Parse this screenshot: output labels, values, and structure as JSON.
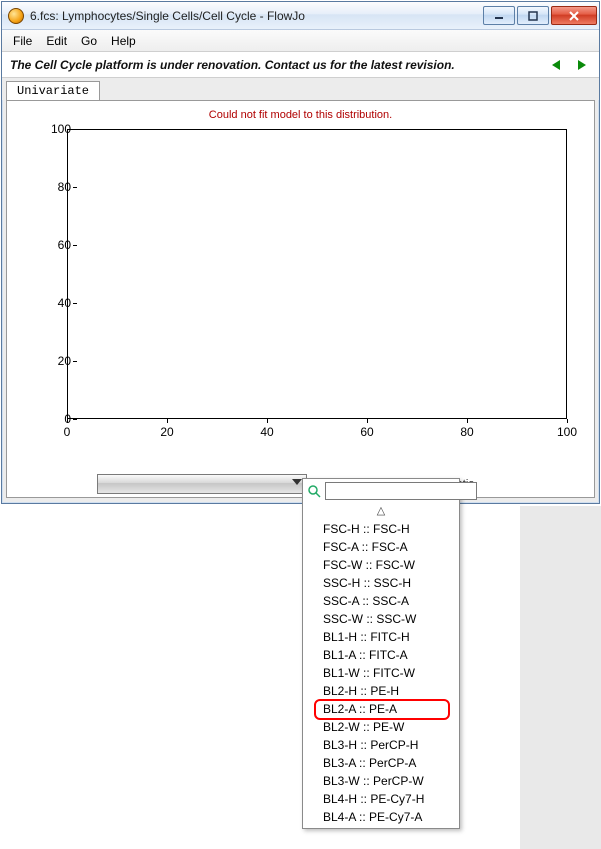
{
  "window": {
    "title": "6.fcs: Lymphocytes/Single Cells/Cell Cycle - FlowJo"
  },
  "menu": {
    "items": [
      "File",
      "Edit",
      "Go",
      "Help"
    ]
  },
  "banner": {
    "message": "The Cell Cycle platform is under renovation.  Contact us for the latest revision."
  },
  "tabs": {
    "active": "Univariate"
  },
  "plot": {
    "fit_error": "Could not fit model to this distribution."
  },
  "bottom": {
    "constrain_label": "ain Ratio"
  },
  "dropdown": {
    "sort_hint": "△",
    "items": [
      "FSC-H :: FSC-H",
      "FSC-A :: FSC-A",
      "FSC-W :: FSC-W",
      "SSC-H :: SSC-H",
      "SSC-A :: SSC-A",
      "SSC-W :: SSC-W",
      "BL1-H :: FITC-H",
      "BL1-A :: FITC-A",
      "BL1-W :: FITC-W",
      "BL2-H :: PE-H",
      "BL2-A :: PE-A",
      "BL2-W :: PE-W",
      "BL3-H :: PerCP-H",
      "BL3-A :: PerCP-A",
      "BL3-W :: PerCP-W",
      "BL4-H :: PE-Cy7-H",
      "BL4-A :: PE-Cy7-A"
    ],
    "highlighted_index": 10
  },
  "chart_data": {
    "type": "line",
    "series": [],
    "x": [],
    "y": [],
    "xlabel": "",
    "ylabel": "",
    "xticks": [
      0,
      20,
      40,
      60,
      80,
      100
    ],
    "yticks": [
      0,
      20,
      40,
      60,
      80,
      100
    ],
    "xlim": [
      0,
      100
    ],
    "ylim": [
      0,
      100
    ],
    "title": ""
  }
}
